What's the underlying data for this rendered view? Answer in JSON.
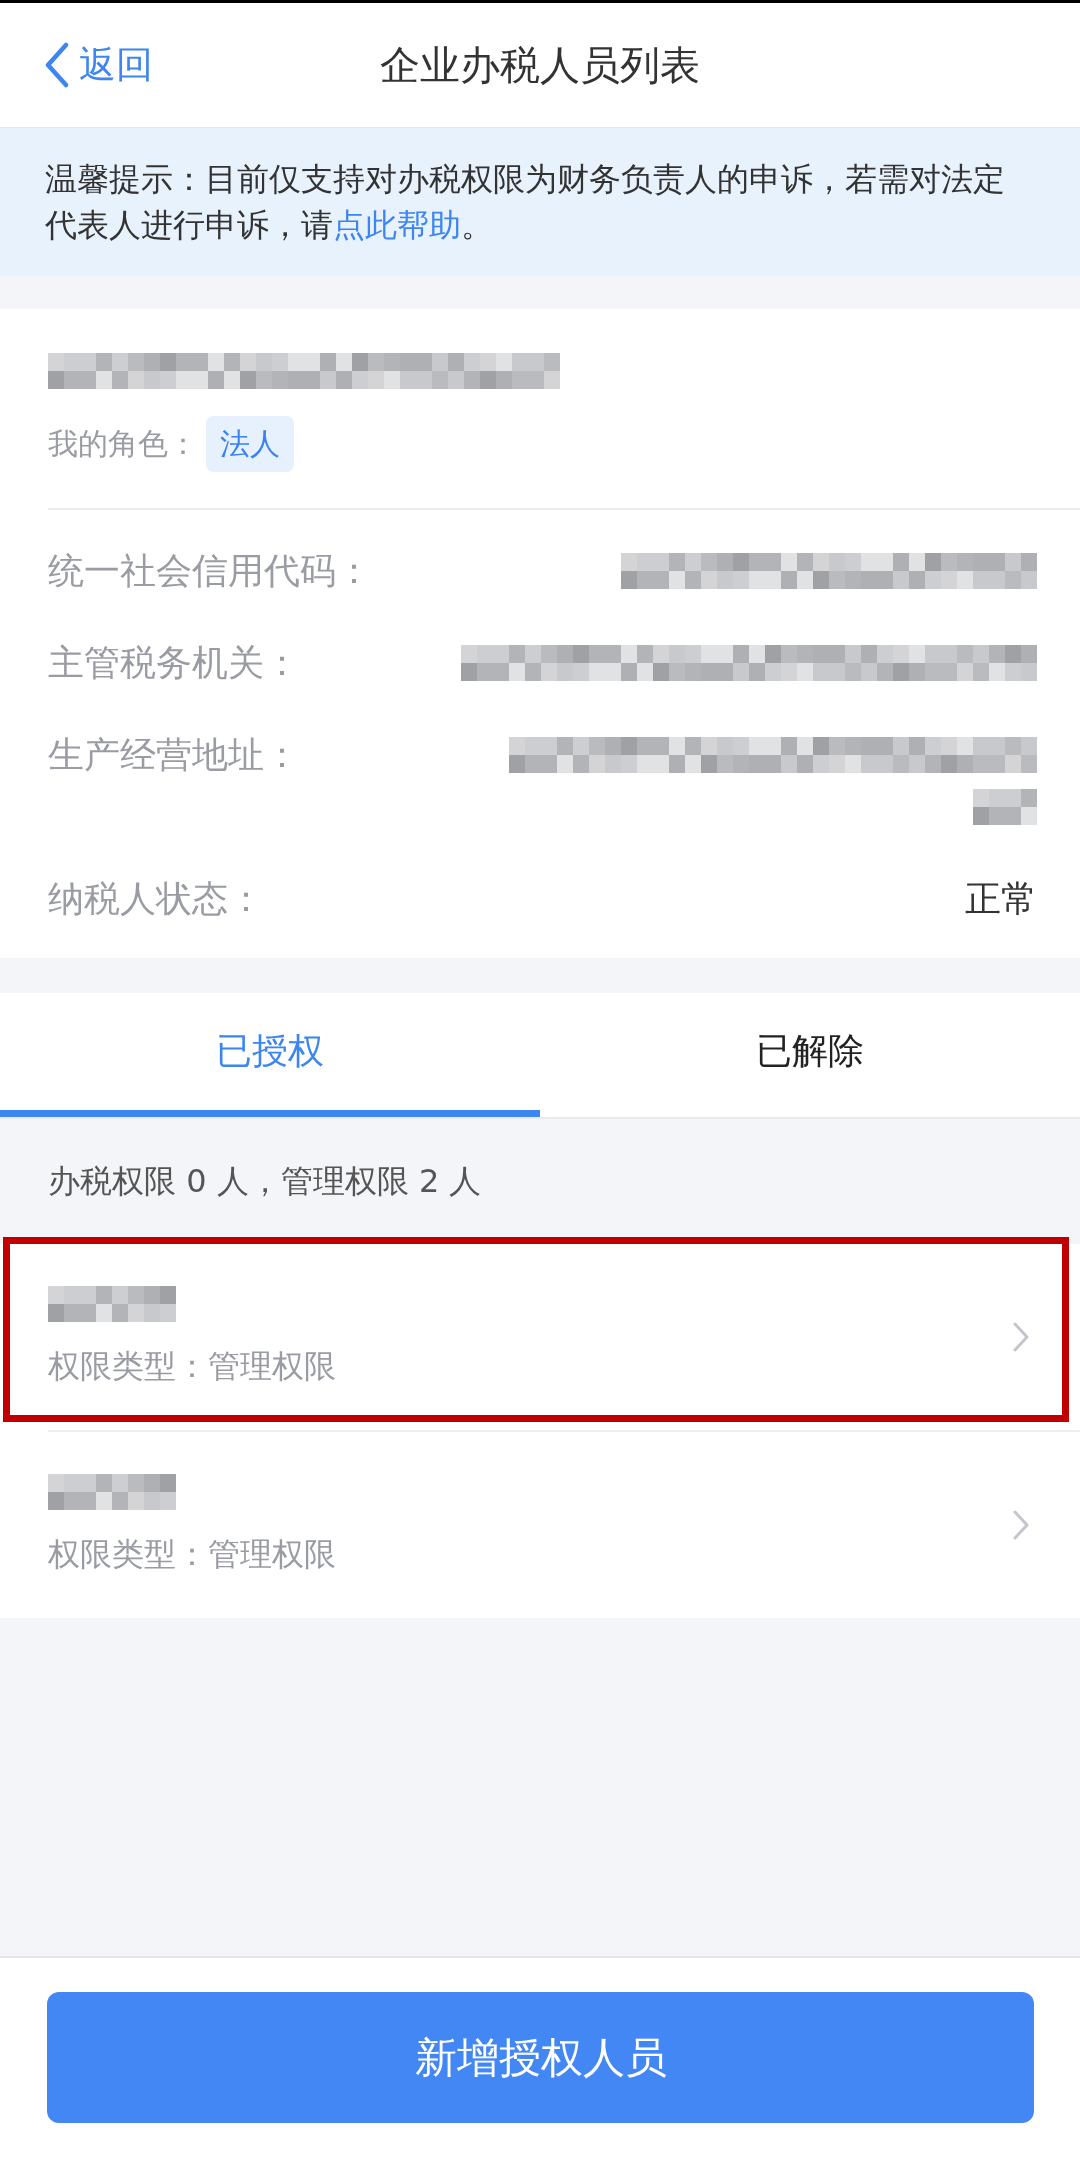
{
  "header": {
    "back": "返回",
    "title": "企业办税人员列表"
  },
  "notice": {
    "text": "温馨提示：目前仅支持对办税权限为财务负责人的申诉，若需对法定代表人进行申诉，请",
    "link": "点此帮助",
    "text_end": "。"
  },
  "company": {
    "name_redacted": true,
    "role_label": "我的角色：",
    "role": "法人",
    "fields": [
      {
        "label": "统一社会信用代码：",
        "value_redacted": true
      },
      {
        "label": "主管税务机关：",
        "value_redacted": true
      },
      {
        "label": "生产经营地址：",
        "value_redacted": true
      },
      {
        "label": "纳税人状态：",
        "value": "正常"
      }
    ]
  },
  "tabs": [
    {
      "label": "已授权",
      "selected": true
    },
    {
      "label": "已解除",
      "selected": false
    }
  ],
  "summary": "办税权限 0 人，管理权限 2 人",
  "people": [
    {
      "name_redacted": true,
      "permission": "权限类型：管理权限",
      "highlighted": true
    },
    {
      "name_redacted": true,
      "permission": "权限类型：管理权限",
      "highlighted": false
    }
  ],
  "button": {
    "label": "新增授权人员"
  }
}
